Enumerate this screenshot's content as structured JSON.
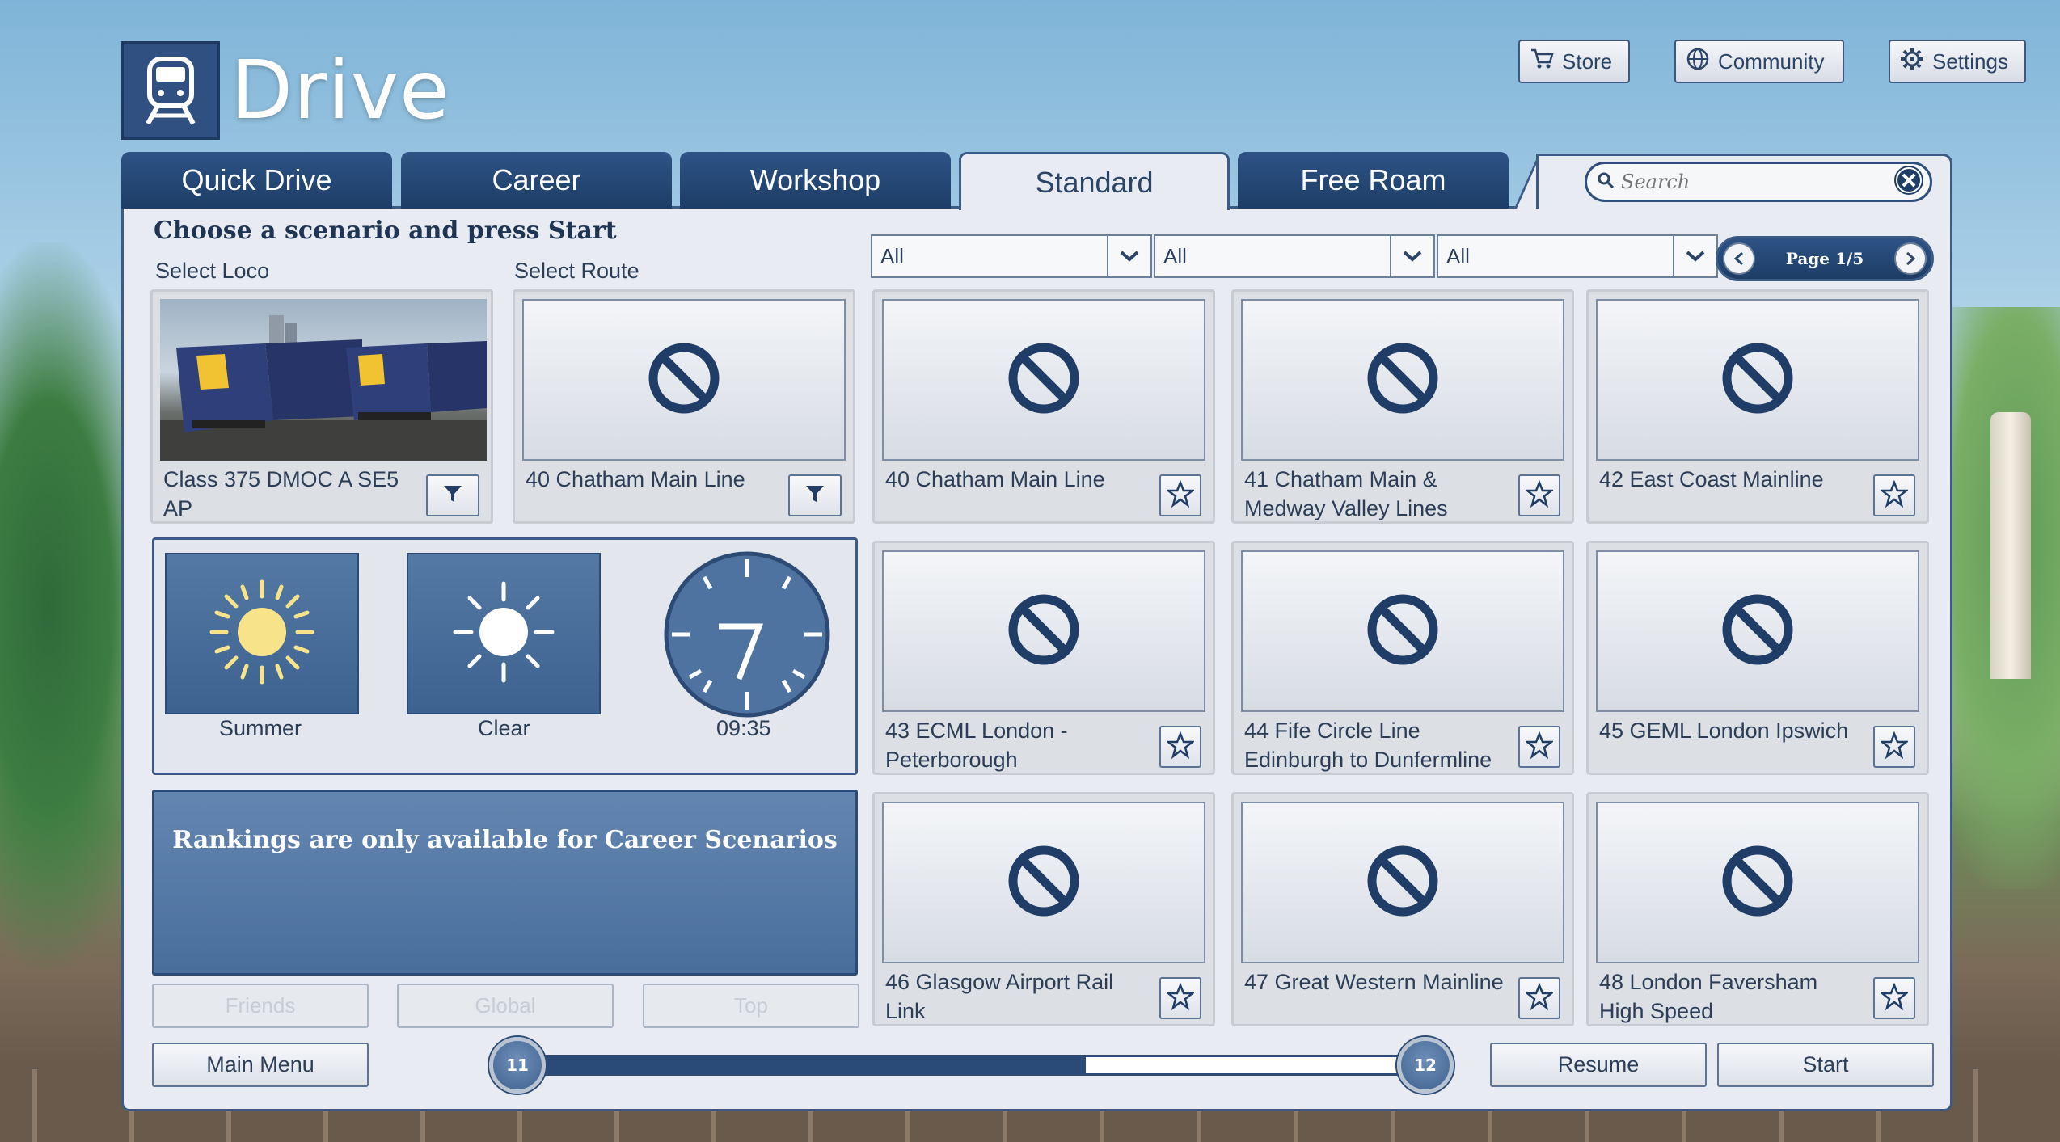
{
  "app": {
    "title": "Drive"
  },
  "top_buttons": {
    "store": "Store",
    "community": "Community",
    "settings": "Settings"
  },
  "tabs": [
    {
      "label": "Quick Drive"
    },
    {
      "label": "Career"
    },
    {
      "label": "Workshop"
    },
    {
      "label": "Standard",
      "active": true
    },
    {
      "label": "Free Roam"
    }
  ],
  "search": {
    "placeholder": "Search",
    "value": ""
  },
  "heading": "Choose a scenario and press Start",
  "select_loco_label": "Select Loco",
  "select_route_label": "Select Route",
  "filters": [
    {
      "value": "All"
    },
    {
      "value": "All"
    },
    {
      "value": "All"
    }
  ],
  "pager": {
    "label": "Page 1/5"
  },
  "loco": {
    "name": "Class 375 DMOC A SE5 AP"
  },
  "route": {
    "name": "40 Chatham Main Line"
  },
  "scenarios": [
    {
      "name": "40 Chatham Main Line"
    },
    {
      "name": "41 Chatham Main & Medway Valley Lines"
    },
    {
      "name": "42 East Coast Mainline"
    },
    {
      "name": "43 ECML London - Peterborough"
    },
    {
      "name": "44 Fife Circle Line Edinburgh to Dunfermline"
    },
    {
      "name": "45 GEML London Ipswich"
    },
    {
      "name": "46 Glasgow Airport Rail Link"
    },
    {
      "name": "47 Great Western Mainline"
    },
    {
      "name": "48 London Faversham High Speed"
    }
  ],
  "environment": {
    "season": "Summer",
    "weather": "Clear",
    "time": "09:35"
  },
  "rankings": {
    "message": "Rankings are only available for Career Scenarios",
    "friends": "Friends",
    "global": "Global",
    "top": "Top"
  },
  "bottom": {
    "main_menu": "Main Menu",
    "resume": "Resume",
    "start": "Start",
    "level_current": "11",
    "level_next": "12",
    "level_progress": 0.64
  },
  "colors": {
    "primary": "#2d5385",
    "panel": "#e8ecf2",
    "accent_sun": "#f7e48a"
  }
}
